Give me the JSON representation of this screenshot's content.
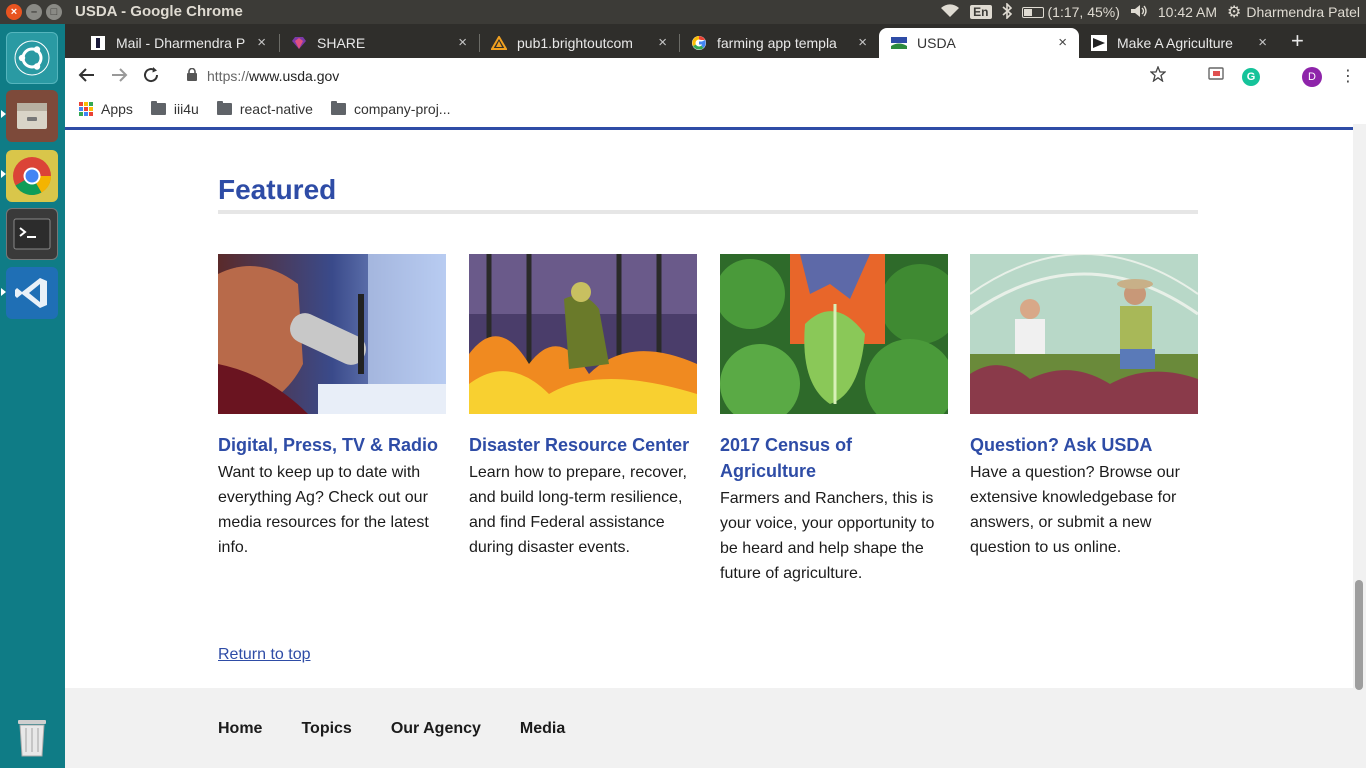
{
  "os": {
    "window_title": "USDA - Google Chrome",
    "keyboard": "En",
    "battery_text": "(1:17, 45%)",
    "battery_level": 0.45,
    "clock": "10:42 AM",
    "user": "Dharmendra Patel"
  },
  "launcher": {
    "items": [
      "ubuntu-dash-icon",
      "files-icon",
      "chrome-icon",
      "terminal-icon",
      "vscode-icon",
      "trash-icon"
    ]
  },
  "browser": {
    "tabs": [
      {
        "label": "Mail - Dharmendra P",
        "icon": "mail-icon"
      },
      {
        "label": "SHARE",
        "icon": "share-icon"
      },
      {
        "label": "pub1.brightoutcom",
        "icon": "pub-icon"
      },
      {
        "label": "farming app templa",
        "icon": "google-icon"
      },
      {
        "label": "USDA",
        "icon": "usda-icon",
        "active": true
      },
      {
        "label": "Make A Agriculture",
        "icon": "agri-icon"
      }
    ],
    "url_scheme": "https://",
    "url_host": "www.usda.gov",
    "profile_initial": "D",
    "bookmarks": [
      "Apps",
      "iii4u",
      "react-native",
      "company-proj..."
    ]
  },
  "page": {
    "featured_heading": "Featured",
    "cards": [
      {
        "title": "Digital, Press, TV & Radio",
        "description": "Want to keep up to date with everything Ag? Check out our media resources for the latest info."
      },
      {
        "title": "Disaster Resource Center",
        "description": "Learn how to prepare, recover, and build long-term resilience, and find Federal assistance during disaster events."
      },
      {
        "title": "2017 Census of Agriculture",
        "description": "Farmers and Ranchers, this is your voice, your opportunity to be heard and help shape the future of agriculture."
      },
      {
        "title": "Question? Ask USDA",
        "description": "Have a question? Browse our extensive knowledgebase for answers, or submit a new question to us online."
      }
    ],
    "return_to_top": "Return to top",
    "footer_nav": [
      "Home",
      "Topics",
      "Our Agency",
      "Media"
    ]
  },
  "colors": {
    "usda_blue": "#2e4ca6",
    "launcher_teal": "#0f7c86",
    "ubuntu_orange": "#e95420"
  }
}
